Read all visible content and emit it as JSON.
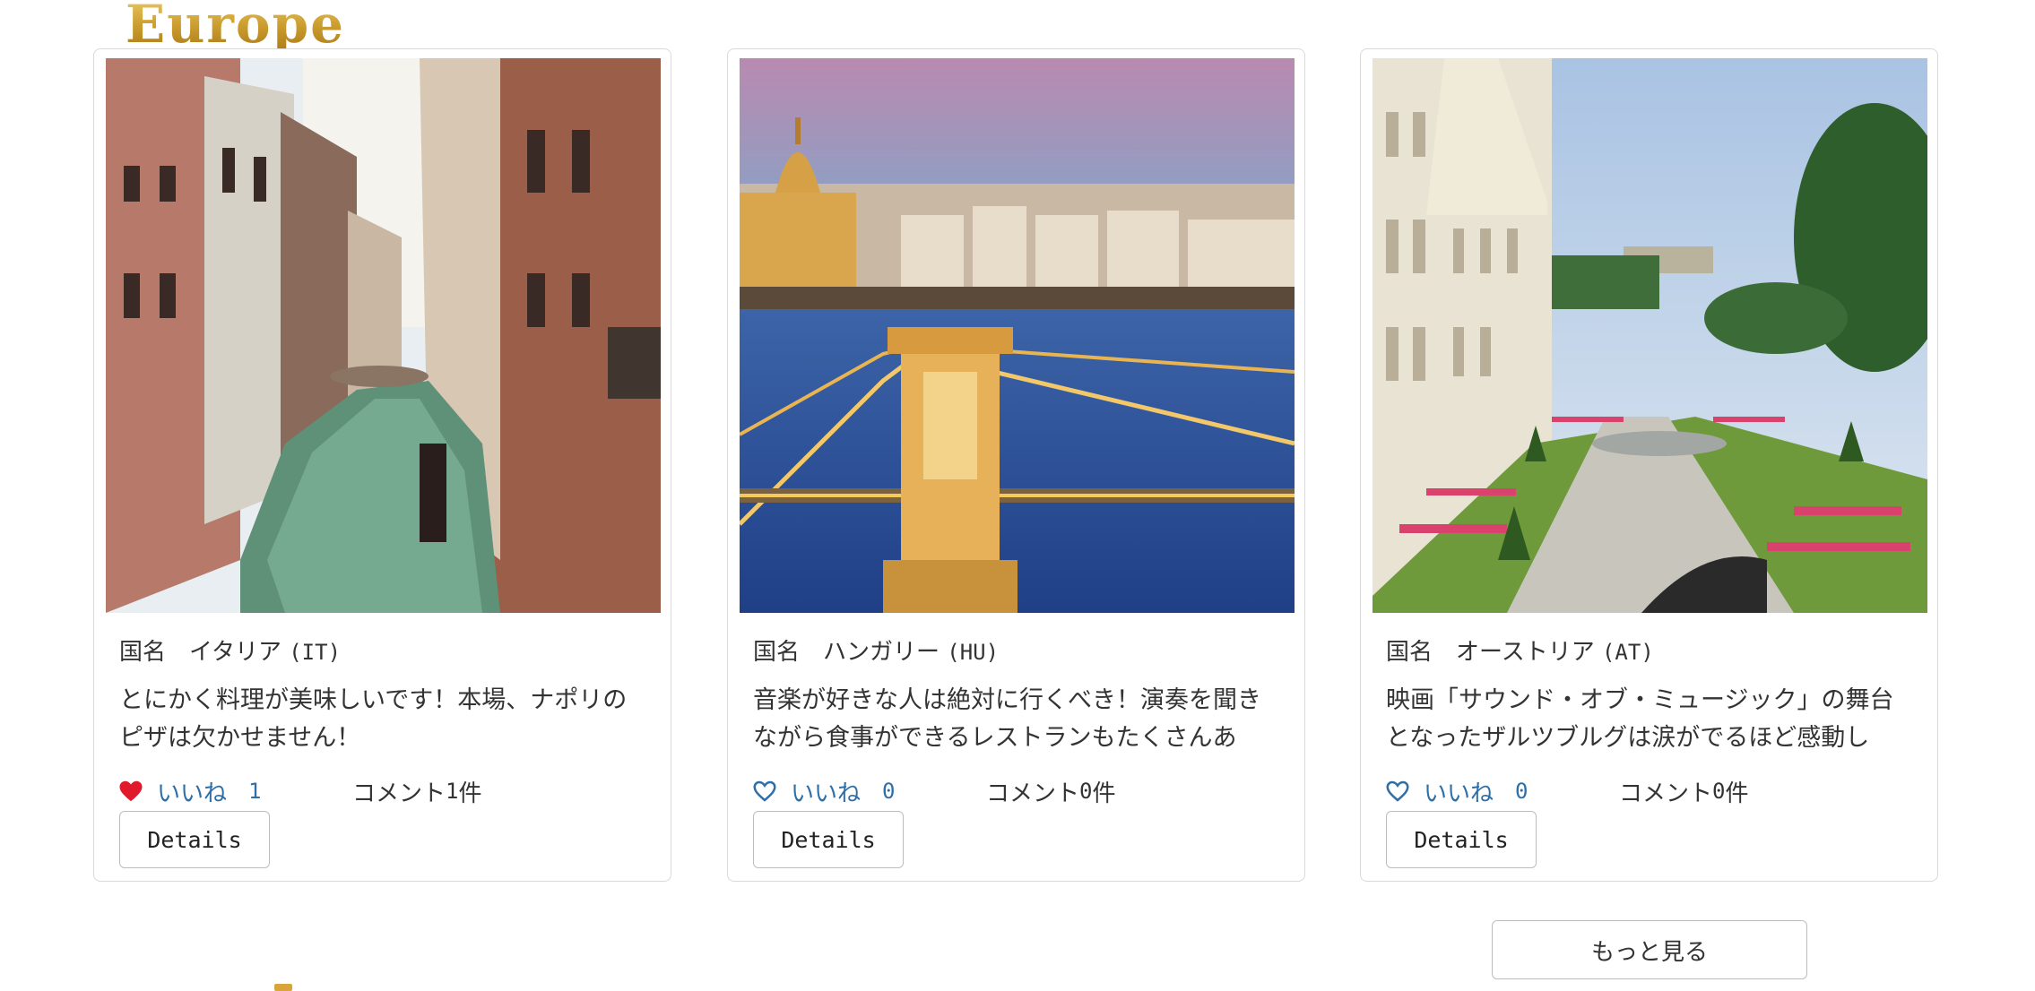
{
  "section": {
    "title": "Europe"
  },
  "cards": [
    {
      "country_label": "国名　イタリア",
      "country_code": "(IT)",
      "description": "とにかく料理が美味しいです！本場、ナポリのピザは欠かせません！",
      "like_label": "いいね",
      "like_count": "1",
      "liked": true,
      "comment_prefix": "コメント",
      "comment_count": "1",
      "comment_suffix": "件",
      "details_label": "Details"
    },
    {
      "country_label": "国名　ハンガリー",
      "country_code": "(HU)",
      "description": "音楽が好きな人は絶対に行くべき！演奏を聞きながら食事ができるレストランもたくさんあ",
      "like_label": "いいね",
      "like_count": "0",
      "liked": false,
      "comment_prefix": "コメント",
      "comment_count": "0",
      "comment_suffix": "件",
      "details_label": "Details"
    },
    {
      "country_label": "国名　オーストリア",
      "country_code": "(AT)",
      "description": "映画「サウンド・オブ・ミュージック」の舞台となったザルツブルグは涙がでるほど感動し",
      "like_label": "いいね",
      "like_count": "0",
      "liked": false,
      "comment_prefix": "コメント",
      "comment_count": "0",
      "comment_suffix": "件",
      "details_label": "Details"
    }
  ],
  "more_button": {
    "label": "もっと見る"
  },
  "colors": {
    "like_blue": "#2f6fa8",
    "heart_red": "#e0192b",
    "title_gold": "#c99a2c"
  }
}
